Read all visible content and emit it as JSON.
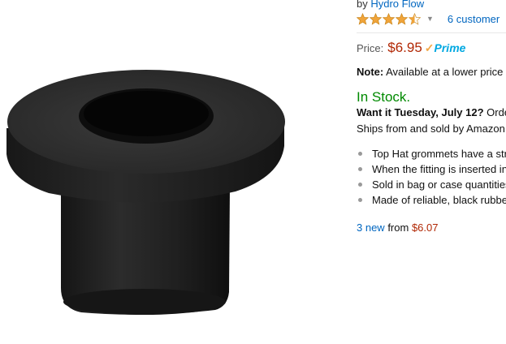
{
  "byline": {
    "prefix": "by ",
    "brand": "Hydro Flow"
  },
  "rating": {
    "stars": 4.5,
    "review_link": "6 customer"
  },
  "price": {
    "label": "Price:",
    "value": "$6.95",
    "prime_label": "Prime"
  },
  "note": {
    "label": "Note:",
    "text": " Available at a lower price"
  },
  "availability": {
    "status": "In Stock."
  },
  "delivery": {
    "bold": "Want it Tuesday, July 12?",
    "text": " Orde"
  },
  "ships_from": "Ships from and sold by Amazon",
  "bullets": [
    "Top Hat grommets have a str",
    "When the fitting is inserted in",
    "Sold in bag or case quantities",
    "Made of reliable, black rubbe"
  ],
  "offers": {
    "link": "3 new",
    "from": " from ",
    "price": "$6.07"
  },
  "colors": {
    "link": "#0066c0",
    "price": "#b12704",
    "in_stock": "#008a00",
    "star": "#f0a43a",
    "prime": "#00a8e1"
  }
}
